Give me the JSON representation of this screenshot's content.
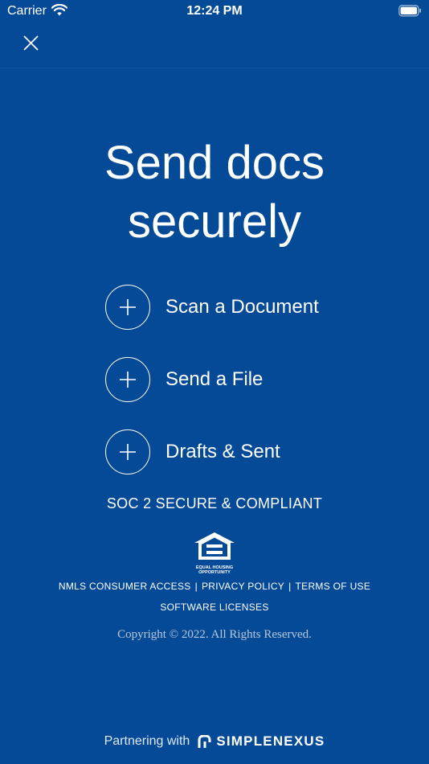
{
  "status_bar": {
    "carrier": "Carrier",
    "time": "12:24 PM"
  },
  "title": {
    "line1": "Send docs",
    "line2": "securely"
  },
  "actions": [
    {
      "label": "Scan a Document",
      "icon": "plus-icon"
    },
    {
      "label": "Send a File",
      "icon": "plus-icon"
    },
    {
      "label": "Drafts & Sent",
      "icon": "plus-icon"
    }
  ],
  "compliance": "SOC 2 SECURE & COMPLIANT",
  "equal_housing": {
    "line1": "EQUAL HOUSING",
    "line2": "OPPORTUNITY"
  },
  "legal_links": {
    "nmls": "NMLS CONSUMER ACCESS",
    "privacy": "PRIVACY POLICY",
    "terms": "TERMS OF USE",
    "separator": "|",
    "licenses": "SOFTWARE LICENSES"
  },
  "copyright": "Copyright © 2022. All Rights Reserved.",
  "partner": {
    "prefix": "Partnering with",
    "brand": "SIMPLENEXUS"
  },
  "colors": {
    "background": "#054a96",
    "text": "#ffffff"
  }
}
